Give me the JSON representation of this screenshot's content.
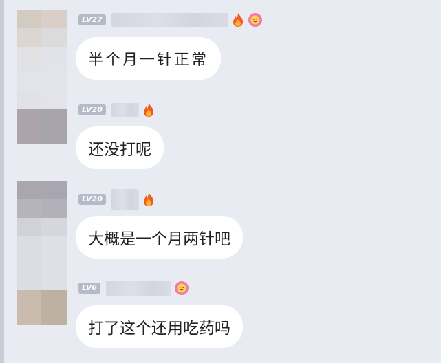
{
  "messages": [
    {
      "level": "LV27",
      "text": "半个月一针正常",
      "badges": [
        "fire-icon",
        "flower-icon"
      ]
    },
    {
      "level": "LV20",
      "text": "还没打呢",
      "badges": [
        "fire-icon"
      ]
    },
    {
      "level": "LV20",
      "text": "大概是一个月两针吧",
      "badges": [
        "fire-icon"
      ]
    },
    {
      "level": "LV6",
      "text": "打了这个还用吃药吗",
      "badges": [
        "flower-icon"
      ]
    }
  ],
  "colors": {
    "background": "#e9ebf3",
    "bubble": "#ffffff",
    "level_badge": "#b5bac9",
    "text": "#222222"
  }
}
